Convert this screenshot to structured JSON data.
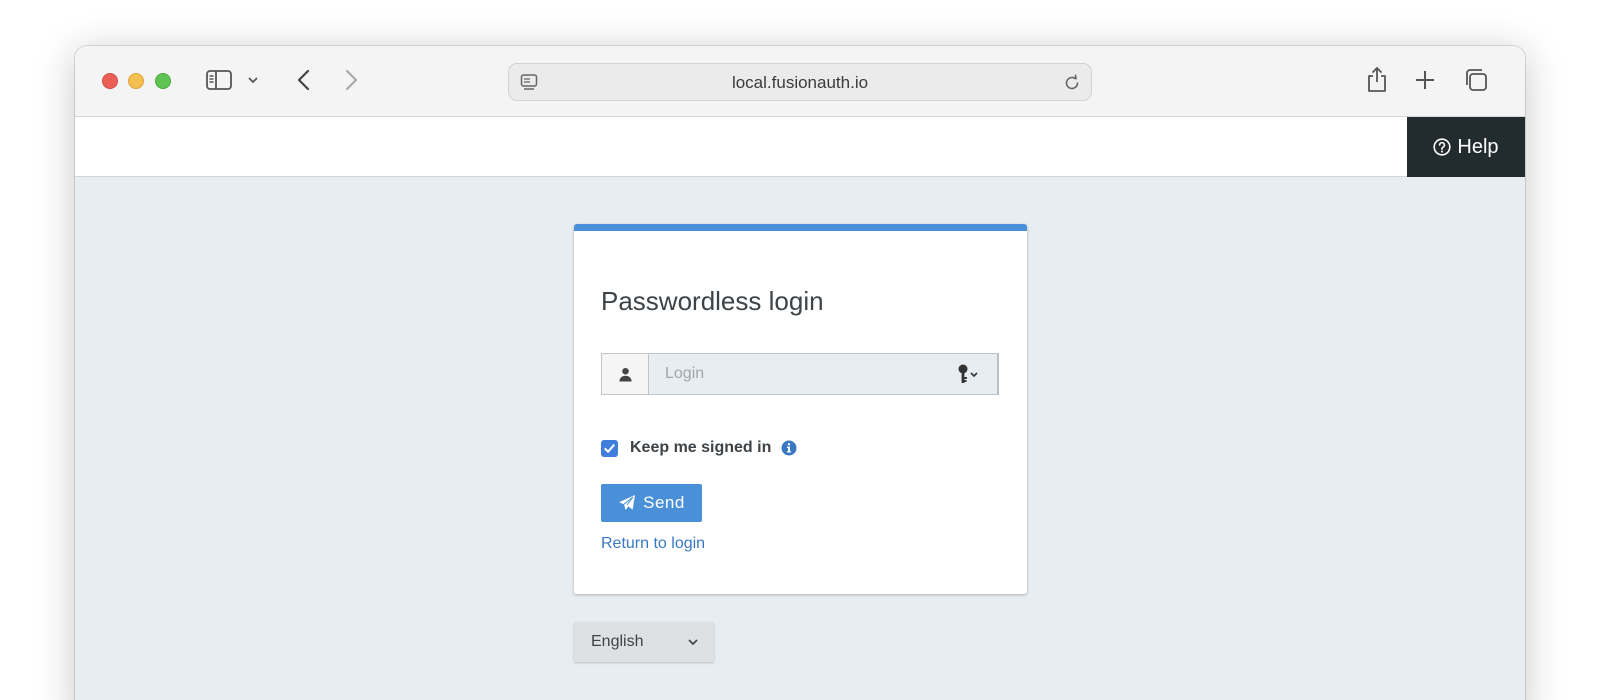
{
  "browser": {
    "url": "local.fusionauth.io"
  },
  "topnav": {
    "help_label": "Help"
  },
  "card": {
    "title": "Passwordless login",
    "login_placeholder": "Login",
    "keep_signed_in_label": "Keep me signed in",
    "keep_signed_in_checked": true,
    "send_label": "Send",
    "return_link": "Return to login"
  },
  "footer": {
    "language_selected": "English"
  },
  "colors": {
    "accent": "#4a90d9",
    "help_bg": "#222b2d",
    "page_bg": "#e8edf2"
  }
}
